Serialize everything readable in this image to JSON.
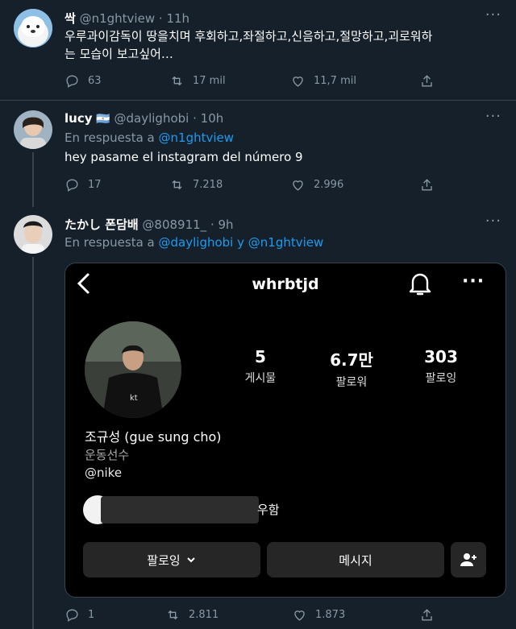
{
  "tweets": [
    {
      "name": "싹",
      "handle": "@n1ghtview",
      "time": "11h",
      "text_line1": "우루과이감독이 땅을치며 후회하고,좌절하고,신음하고,절망하고,괴로워하",
      "text_line2": "는 모습이 보고싶어…",
      "replies": "63",
      "retweets": "17 mil",
      "likes": "11,7 mil"
    },
    {
      "name": "lucy",
      "flag": "🇦🇷",
      "handle": "@daylighobi",
      "time": "10h",
      "reply_prefix": "En respuesta a",
      "reply_to": "@n1ghtview",
      "text": "hey pasame el instagram del número 9",
      "replies": "17",
      "retweets": "7.218",
      "likes": "2.996"
    },
    {
      "name": "たかし 폰담배",
      "handle": "@808911_",
      "time": "9h",
      "reply_prefix": "En respuesta a",
      "reply_to": "@daylighobi y @n1ghtview",
      "replies": "1",
      "retweets": "2.811",
      "likes": "1.873"
    }
  ],
  "instagram": {
    "username": "whrbtjd",
    "posts_count": "5",
    "posts_label": "게시물",
    "followers_count": "6.7만",
    "followers_label": "팔로워",
    "following_count": "303",
    "following_label": "팔로잉",
    "display_name": "조규성 (gue sung cho)",
    "category": "운동선수",
    "bio_mention": "@nike",
    "mutual_suffix": "우함",
    "following_button": "팔로잉",
    "message_button": "메시지"
  },
  "icons": [
    "reply-icon",
    "retweet-icon",
    "like-icon",
    "share-icon",
    "back-arrow-icon",
    "bell-icon",
    "more-icon",
    "chevron-down-icon",
    "add-person-icon"
  ]
}
